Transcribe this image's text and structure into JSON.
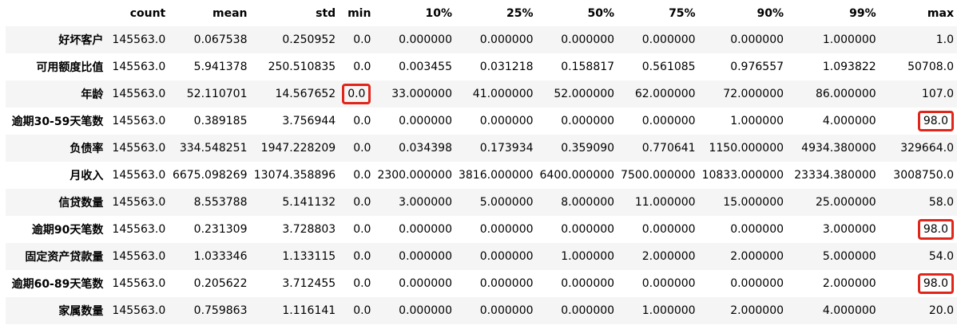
{
  "table": {
    "columns": [
      "",
      "count",
      "mean",
      "std",
      "min",
      "10%",
      "25%",
      "50%",
      "75%",
      "90%",
      "99%",
      "max"
    ],
    "rows": [
      {
        "label": "好坏客户",
        "cells": [
          "145563.0",
          "0.067538",
          "0.250952",
          "0.0",
          "0.000000",
          "0.000000",
          "0.000000",
          "0.000000",
          "0.000000",
          "1.000000",
          "1.0"
        ]
      },
      {
        "label": "可用额度比值",
        "cells": [
          "145563.0",
          "5.941378",
          "250.510835",
          "0.0",
          "0.003455",
          "0.031218",
          "0.158817",
          "0.561085",
          "0.976557",
          "1.093822",
          "50708.0"
        ]
      },
      {
        "label": "年龄",
        "cells": [
          "145563.0",
          "52.110701",
          "14.567652",
          "0.0",
          "33.000000",
          "41.000000",
          "52.000000",
          "62.000000",
          "72.000000",
          "86.000000",
          "107.0"
        ],
        "highlight": [
          3
        ]
      },
      {
        "label": "逾期30-59天笔数",
        "cells": [
          "145563.0",
          "0.389185",
          "3.756944",
          "0.0",
          "0.000000",
          "0.000000",
          "0.000000",
          "0.000000",
          "1.000000",
          "4.000000",
          "98.0"
        ],
        "highlight": [
          10
        ]
      },
      {
        "label": "负债率",
        "cells": [
          "145563.0",
          "334.548251",
          "1947.228209",
          "0.0",
          "0.034398",
          "0.173934",
          "0.359090",
          "0.770641",
          "1150.000000",
          "4934.380000",
          "329664.0"
        ]
      },
      {
        "label": "月收入",
        "cells": [
          "145563.0",
          "6675.098269",
          "13074.358896",
          "0.0",
          "2300.000000",
          "3816.000000",
          "6400.000000",
          "7500.000000",
          "10833.000000",
          "23334.380000",
          "3008750.0"
        ]
      },
      {
        "label": "信贷数量",
        "cells": [
          "145563.0",
          "8.553788",
          "5.141132",
          "0.0",
          "3.000000",
          "5.000000",
          "8.000000",
          "11.000000",
          "15.000000",
          "25.000000",
          "58.0"
        ]
      },
      {
        "label": "逾期90天笔数",
        "cells": [
          "145563.0",
          "0.231309",
          "3.728803",
          "0.0",
          "0.000000",
          "0.000000",
          "0.000000",
          "0.000000",
          "0.000000",
          "3.000000",
          "98.0"
        ],
        "highlight": [
          10
        ]
      },
      {
        "label": "固定资产贷款量",
        "cells": [
          "145563.0",
          "1.033346",
          "1.133115",
          "0.0",
          "0.000000",
          "0.000000",
          "1.000000",
          "2.000000",
          "2.000000",
          "5.000000",
          "54.0"
        ]
      },
      {
        "label": "逾期60-89天笔数",
        "cells": [
          "145563.0",
          "0.205622",
          "3.712455",
          "0.0",
          "0.000000",
          "0.000000",
          "0.000000",
          "0.000000",
          "0.000000",
          "2.000000",
          "98.0"
        ],
        "highlight": [
          10
        ]
      },
      {
        "label": "家属数量",
        "cells": [
          "145563.0",
          "0.759863",
          "1.116141",
          "0.0",
          "0.000000",
          "0.000000",
          "0.000000",
          "1.000000",
          "2.000000",
          "4.000000",
          "20.0"
        ]
      }
    ]
  },
  "colors": {
    "row_stripe": "#f5f5f5",
    "highlight_border": "#e0261b"
  }
}
